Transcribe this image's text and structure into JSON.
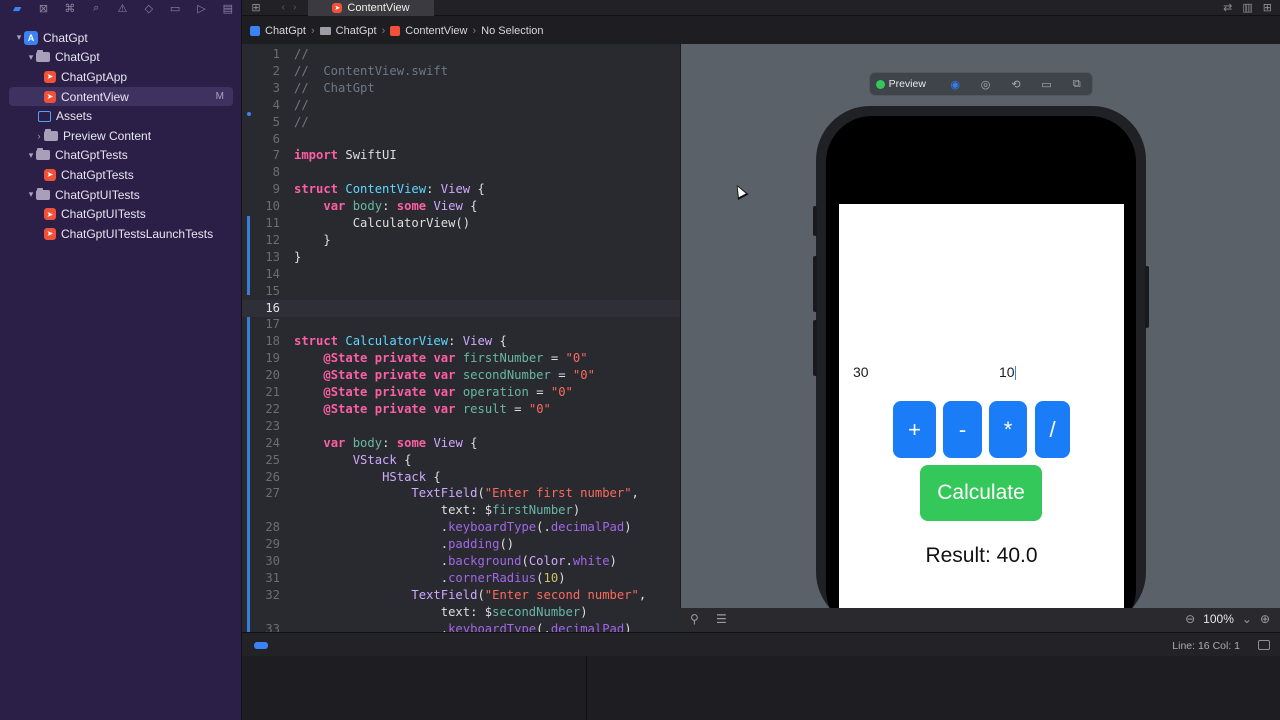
{
  "tab": {
    "active_label": "ContentView"
  },
  "breadcrumb": {
    "project": "ChatGpt",
    "folder": "ChatGpt",
    "file": "ContentView",
    "selection": "No Selection"
  },
  "sidebar": {
    "items": [
      {
        "label": "ChatGpt",
        "kind": "project"
      },
      {
        "label": "ChatGpt",
        "kind": "folder"
      },
      {
        "label": "ChatGptApp",
        "kind": "swift"
      },
      {
        "label": "ContentView",
        "kind": "swift",
        "badge": "M"
      },
      {
        "label": "Assets",
        "kind": "assets"
      },
      {
        "label": "Preview Content",
        "kind": "folder"
      },
      {
        "label": "ChatGptTests",
        "kind": "folder"
      },
      {
        "label": "ChatGptTests",
        "kind": "swift"
      },
      {
        "label": "ChatGptUITests",
        "kind": "folder"
      },
      {
        "label": "ChatGptUITests",
        "kind": "swift"
      },
      {
        "label": "ChatGptUITestsLaunchTests",
        "kind": "swift"
      }
    ]
  },
  "editor": {
    "current_line": 16,
    "lines": [
      {
        "n": "1",
        "code": "//"
      },
      {
        "n": "2",
        "code": "//  ContentView.swift"
      },
      {
        "n": "3",
        "code": "//  ChatGpt"
      },
      {
        "n": "4",
        "code": "//"
      },
      {
        "n": "5",
        "code": "//"
      },
      {
        "n": "6",
        "code": ""
      },
      {
        "n": "7",
        "code": "import SwiftUI"
      },
      {
        "n": "8",
        "code": ""
      },
      {
        "n": "9",
        "code": "struct ContentView: View {"
      },
      {
        "n": "10",
        "code": "    var body: some View {"
      },
      {
        "n": "11",
        "code": "        CalculatorView()"
      },
      {
        "n": "12",
        "code": "    }"
      },
      {
        "n": "13",
        "code": "}"
      },
      {
        "n": "14",
        "code": ""
      },
      {
        "n": "15",
        "code": ""
      },
      {
        "n": "16",
        "code": ""
      },
      {
        "n": "17",
        "code": ""
      },
      {
        "n": "18",
        "code": "struct CalculatorView: View {"
      },
      {
        "n": "19",
        "code": "    @State private var firstNumber = \"0\""
      },
      {
        "n": "20",
        "code": "    @State private var secondNumber = \"0\""
      },
      {
        "n": "21",
        "code": "    @State private var operation = \"0\""
      },
      {
        "n": "22",
        "code": "    @State private var result = \"0\""
      },
      {
        "n": "23",
        "code": ""
      },
      {
        "n": "24",
        "code": "    var body: some View {"
      },
      {
        "n": "25",
        "code": "        VStack {"
      },
      {
        "n": "26",
        "code": "            HStack {"
      },
      {
        "n": "27",
        "code": "                TextField(\"Enter first number\","
      },
      {
        "n": "",
        "code": "                    text: $firstNumber)"
      },
      {
        "n": "28",
        "code": "                    .keyboardType(.decimalPad)"
      },
      {
        "n": "29",
        "code": "                    .padding()"
      },
      {
        "n": "30",
        "code": "                    .background(Color.white)"
      },
      {
        "n": "31",
        "code": "                    .cornerRadius(10)"
      },
      {
        "n": "32",
        "code": "                TextField(\"Enter second number\","
      },
      {
        "n": "",
        "code": "                    text: $secondNumber)"
      },
      {
        "n": "33",
        "code": "                    .keyboardType(.decimalPad)"
      }
    ]
  },
  "preview": {
    "label": "Preview",
    "first_field": "30",
    "second_field": "10",
    "operators": [
      "+",
      "-",
      "*",
      "/"
    ],
    "calculate_label": "Calculate",
    "result_text": "Result: 40.0",
    "zoom": "100%",
    "accent": "#1a7cf6",
    "calc_color": "#34c759"
  },
  "status": {
    "text": "Line: 16  Col: 1"
  }
}
